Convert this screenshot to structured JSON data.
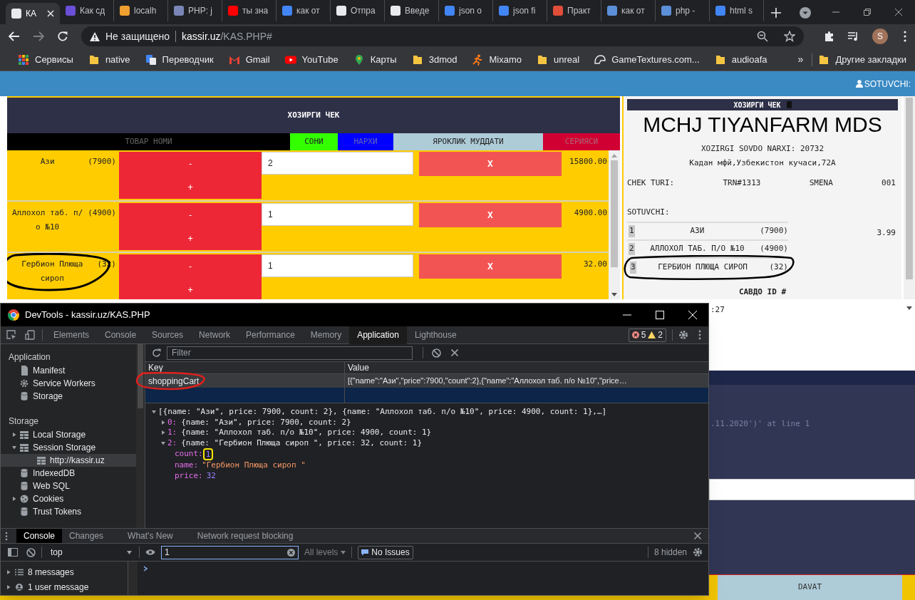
{
  "browser": {
    "tabs": [
      {
        "title": "КА",
        "selected": true,
        "color": "#e8eaed"
      },
      {
        "title": "Как сд",
        "selected": false,
        "color": "#6b4fd8"
      },
      {
        "title": "localh",
        "selected": false,
        "color": "#f0a030"
      },
      {
        "title": "PHP: j",
        "selected": false,
        "color": "#7a86b8"
      },
      {
        "title": "ты зна",
        "selected": false,
        "color": "#ff0000"
      },
      {
        "title": "как от",
        "selected": false,
        "color": "#4285f4"
      },
      {
        "title": "Отпра",
        "selected": false,
        "color": "#e8eaed"
      },
      {
        "title": "Введе",
        "selected": false,
        "color": "#e8eaed"
      },
      {
        "title": "json o",
        "selected": false,
        "color": "#4285f4"
      },
      {
        "title": "json fi",
        "selected": false,
        "color": "#4285f4"
      },
      {
        "title": "Практ",
        "selected": false,
        "color": "#e04e39"
      },
      {
        "title": "как от",
        "selected": false,
        "color": "#5b8fd8"
      },
      {
        "title": "php -",
        "selected": false,
        "color": "#5b8fd8"
      },
      {
        "title": "html s",
        "selected": false,
        "color": "#4285f4"
      }
    ],
    "address": {
      "security": "Не защищено",
      "host": "kassir.uz",
      "path": "/KAS.PHP#"
    },
    "avatar": "S",
    "bookmarks": [
      {
        "label": "Сервисы",
        "kind": "apps"
      },
      {
        "label": "native",
        "kind": "folder"
      },
      {
        "label": "Переводчик",
        "kind": "translate"
      },
      {
        "label": "Gmail",
        "kind": "mail"
      },
      {
        "label": "YouTube",
        "kind": "video"
      },
      {
        "label": "Карты",
        "kind": "pin"
      },
      {
        "label": "3dmod",
        "kind": "folder"
      },
      {
        "label": "Mixamo",
        "kind": "figure"
      },
      {
        "label": "unreal",
        "kind": "folder"
      },
      {
        "label": "GameTextures.com...",
        "kind": "logo"
      },
      {
        "label": "audioafa",
        "kind": "folder"
      }
    ],
    "more": "»",
    "other": "Другие закладки"
  },
  "page": {
    "header": {
      "user": "SOTUVCHI:"
    },
    "cart": {
      "title": "ХОЗИРГИ ЧЕК",
      "columns": [
        {
          "label": "ТОВАР НОМИ",
          "color": "#000000"
        },
        {
          "label": "СОНИ",
          "color": "#33ff00"
        },
        {
          "label": "НАРХИ",
          "color": "#0000ff"
        },
        {
          "label": "ЯРОКЛИК МУДДАТИ",
          "color": "#aecbd8"
        },
        {
          "label": "СЕРИЯСИ",
          "color": "#d10032"
        }
      ],
      "rows": [
        {
          "name": "Ази",
          "price": "(7900)",
          "minus": "-",
          "plus": "+",
          "count": "2",
          "remove": "X",
          "total": "15800.00",
          "circled": false
        },
        {
          "name": "Аллохол таб. п/ о №10",
          "price": "(4900)",
          "minus": "-",
          "plus": "+",
          "count": "1",
          "remove": "X",
          "total": "4900.00",
          "circled": false
        },
        {
          "name": "Гербион Плюща сироп",
          "price": "(32)",
          "minus": "-",
          "plus": "+",
          "count": "1",
          "remove": "X",
          "total": "32.00",
          "circled": true
        }
      ]
    },
    "receipt": {
      "title": "ХОЗИРГИ ЧЕК",
      "company": "MCHJ TIYANFARM MDS",
      "sum_line": "XOZIRGI SOVDO NARXI: 20732",
      "address": "Кадан мфй,Узбекистон кучаси,72А",
      "meta": [
        "CHEK TURI:",
        "TRN#1313",
        "SMENA",
        "001"
      ],
      "seller": "SOTUVCHI:",
      "items": [
        {
          "num": "1",
          "name": "АЗИ",
          "price": "(7900)",
          "circled": false
        },
        {
          "num": "2",
          "name": "АЛЛОХОЛ ТАБ. П/О №10",
          "price": "(4900)",
          "circled": false
        },
        {
          "num": "3",
          "name": "ГЕРБИОН ПЛЮЩА СИРОП",
          "price": "(32)",
          "circled": true
        }
      ],
      "side_value": "3.99",
      "footer": "САВДО ID #"
    },
    "background": {
      "time_fragment": ":27",
      "error_fragment": ".11.2020')' at line 1",
      "button": "DAVAT"
    }
  },
  "devtools": {
    "title": "DevTools - kassir.uz/KAS.PHP",
    "panels": [
      {
        "label": "Elements",
        "selected": false
      },
      {
        "label": "Console",
        "selected": false
      },
      {
        "label": "Sources",
        "selected": false
      },
      {
        "label": "Network",
        "selected": false
      },
      {
        "label": "Performance",
        "selected": false
      },
      {
        "label": "Memory",
        "selected": false
      },
      {
        "label": "Application",
        "selected": true
      },
      {
        "label": "Lighthouse",
        "selected": false
      }
    ],
    "errors": "5",
    "warnings": "2",
    "sidebar": {
      "sections": [
        {
          "title": "Application",
          "items": [
            {
              "label": "Manifest",
              "kind": "file",
              "selected": false
            },
            {
              "label": "Service Workers",
              "kind": "gear",
              "selected": false
            },
            {
              "label": "Storage",
              "kind": "db",
              "selected": false
            }
          ]
        },
        {
          "title": "Storage",
          "items": [
            {
              "label": "Local Storage",
              "kind": "grid",
              "selected": false,
              "expanded": false
            },
            {
              "label": "Session Storage",
              "kind": "grid",
              "selected": false,
              "expanded": true,
              "children": [
                {
                  "label": "http://kassir.uz",
                  "kind": "grid",
                  "selected": true
                }
              ]
            },
            {
              "label": "IndexedDB",
              "kind": "db",
              "selected": false
            },
            {
              "label": "Web SQL",
              "kind": "db",
              "selected": false
            },
            {
              "label": "Cookies",
              "kind": "cookie",
              "selected": false,
              "expanded": false
            },
            {
              "label": "Trust Tokens",
              "kind": "db",
              "selected": false
            }
          ]
        }
      ]
    },
    "filter": {
      "placeholder": "Filter"
    },
    "storage": {
      "columns": [
        "Key",
        "Value"
      ],
      "rows": [
        {
          "key": "shoppingCart",
          "value": "[{\"name\":\"Ази\",\"price\":7900,\"count\":2},{\"name\":\"Аллохол таб. п/о №10\",\"price…",
          "selected": true,
          "circled": true
        }
      ]
    },
    "preview": {
      "summary": "[{name: \"Ази\", price: 7900, count: 2}, {name: \"Аллохол таб. п/о №10\", price: 4900, count: 1},…]",
      "expanded": true,
      "children": [
        {
          "key": "0:",
          "summary": "{name: \"Ази\", price: 7900, count: 2}",
          "expanded": false
        },
        {
          "key": "1:",
          "summary": "{name: \"Аллохол таб. п/о №10\", price: 4900, count: 1}",
          "expanded": false
        },
        {
          "key": "2:",
          "summary": "{name: \"Гербион Плюща сироп \", price: 32, count: 1}",
          "expanded": true,
          "children": [
            {
              "key": "count:",
              "value": "1",
              "kind": "number",
              "highlighted": true
            },
            {
              "key": "name:",
              "value": "\"Гербион Плюща сироп \"",
              "kind": "string",
              "highlighted": false
            },
            {
              "key": "price:",
              "value": "32",
              "kind": "number",
              "highlighted": false
            }
          ]
        }
      ]
    },
    "drawer": {
      "tabs": [
        {
          "label": "Console",
          "selected": true
        },
        {
          "label": "Changes",
          "selected": false
        },
        {
          "label": "What's New",
          "selected": false
        },
        {
          "label": "Network request blocking",
          "selected": false
        }
      ],
      "context": "top",
      "filter_value": "1",
      "levels": "All levels",
      "issues": "No Issues",
      "hidden": "8 hidden",
      "groups": [
        {
          "label": "8 messages",
          "kind": "list"
        },
        {
          "label": "1 user message",
          "kind": "user"
        }
      ]
    }
  }
}
